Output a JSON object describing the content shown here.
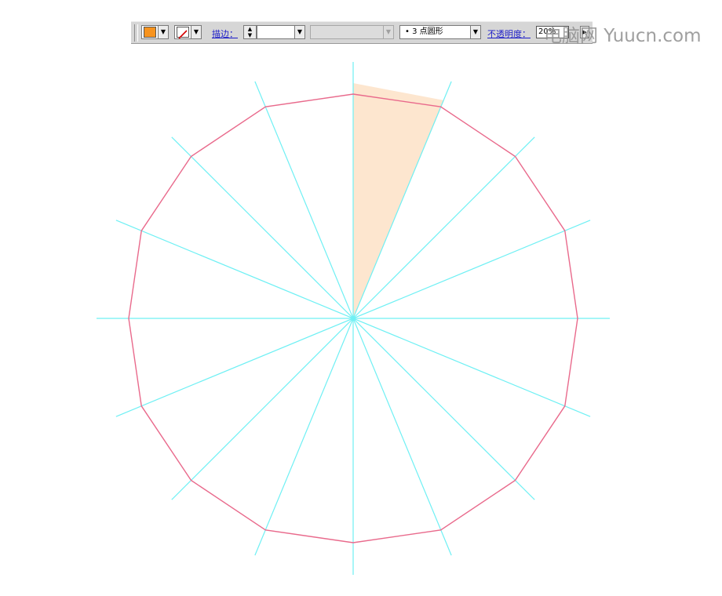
{
  "toolbar": {
    "fill_color": "#f7931e",
    "stroke_color": "none",
    "stroke_label": "描边：",
    "stroke_weight": "",
    "variable_width": "",
    "brush_label": "3 点圆形",
    "opacity_label": "不透明度：",
    "opacity_value": "20%"
  },
  "watermark": "电脑网 Yuucn.com",
  "artwork": {
    "polygon_sides": 16,
    "guide_lines": 8,
    "polygon_stroke": "#e96a8c",
    "guide_color": "#6ff0f4",
    "wedge_fill": "#fde6cf"
  }
}
